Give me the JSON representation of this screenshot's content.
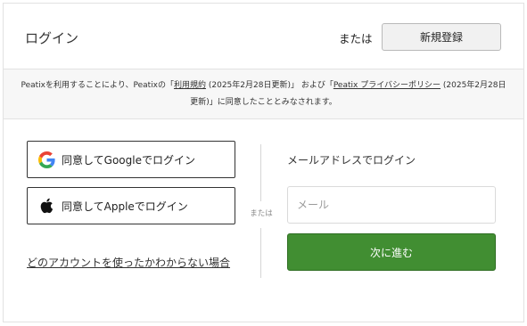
{
  "header": {
    "title": "ログイン",
    "or_text": "または",
    "signup_label": "新規登録"
  },
  "terms": {
    "part1": "Peatixを利用することにより、Peatixの「",
    "terms_link": "利用規約",
    "part2": " (2025年2月28日更新)」 および「",
    "privacy_link": "Peatix プライバシーポリシー",
    "part3": " (2025年2月28日更新)」に同意したこととみなされます。"
  },
  "social": {
    "google_label": "同意してGoogleでログイン",
    "apple_label": "同意してAppleでログイン",
    "help_link": "どのアカウントを使ったかわからない場合"
  },
  "divider": {
    "or_text": "または"
  },
  "email_login": {
    "title": "メールアドレスでログイン",
    "placeholder": "メール",
    "next_label": "次に進む"
  },
  "colors": {
    "accent_green": "#418e32",
    "google_blue": "#4285F4",
    "google_red": "#EA4335",
    "google_yellow": "#FBBC05",
    "google_green": "#34A853"
  }
}
